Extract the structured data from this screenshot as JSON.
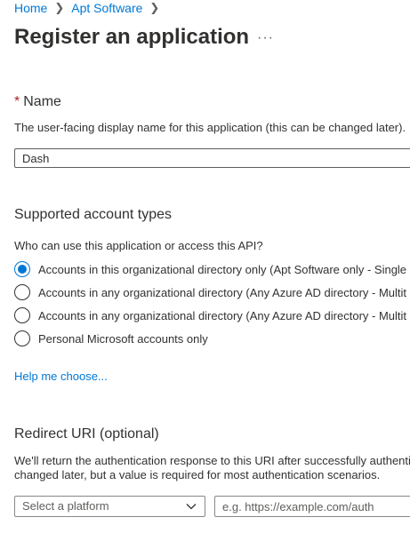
{
  "breadcrumb": [
    "Home",
    "Apt Software"
  ],
  "page_title": "Register an application",
  "more_label": "···",
  "name_section": {
    "required_marker": "*",
    "label": "Name",
    "description": "The user-facing display name for this application (this can be changed later).",
    "value": "Dash"
  },
  "account_types": {
    "heading": "Supported account types",
    "question": "Who can use this application or access this API?",
    "options": [
      {
        "label": "Accounts in this organizational directory only (Apt Software only - Single",
        "selected": true
      },
      {
        "label": "Accounts in any organizational directory (Any Azure AD directory - Multit",
        "selected": false
      },
      {
        "label": "Accounts in any organizational directory (Any Azure AD directory - Multit",
        "selected": false
      },
      {
        "label": "Personal Microsoft accounts only",
        "selected": false
      }
    ],
    "help_link": "Help me choose..."
  },
  "redirect": {
    "heading": "Redirect URI (optional)",
    "description_line1": "We'll return the authentication response to this URI after successfully authenti",
    "description_line2": "changed later, but a value is required for most authentication scenarios.",
    "platform_placeholder": "Select a platform",
    "uri_placeholder": "e.g. https://example.com/auth"
  },
  "colors": {
    "accent": "#0078d4",
    "required": "#a4262c",
    "text": "#323130"
  }
}
